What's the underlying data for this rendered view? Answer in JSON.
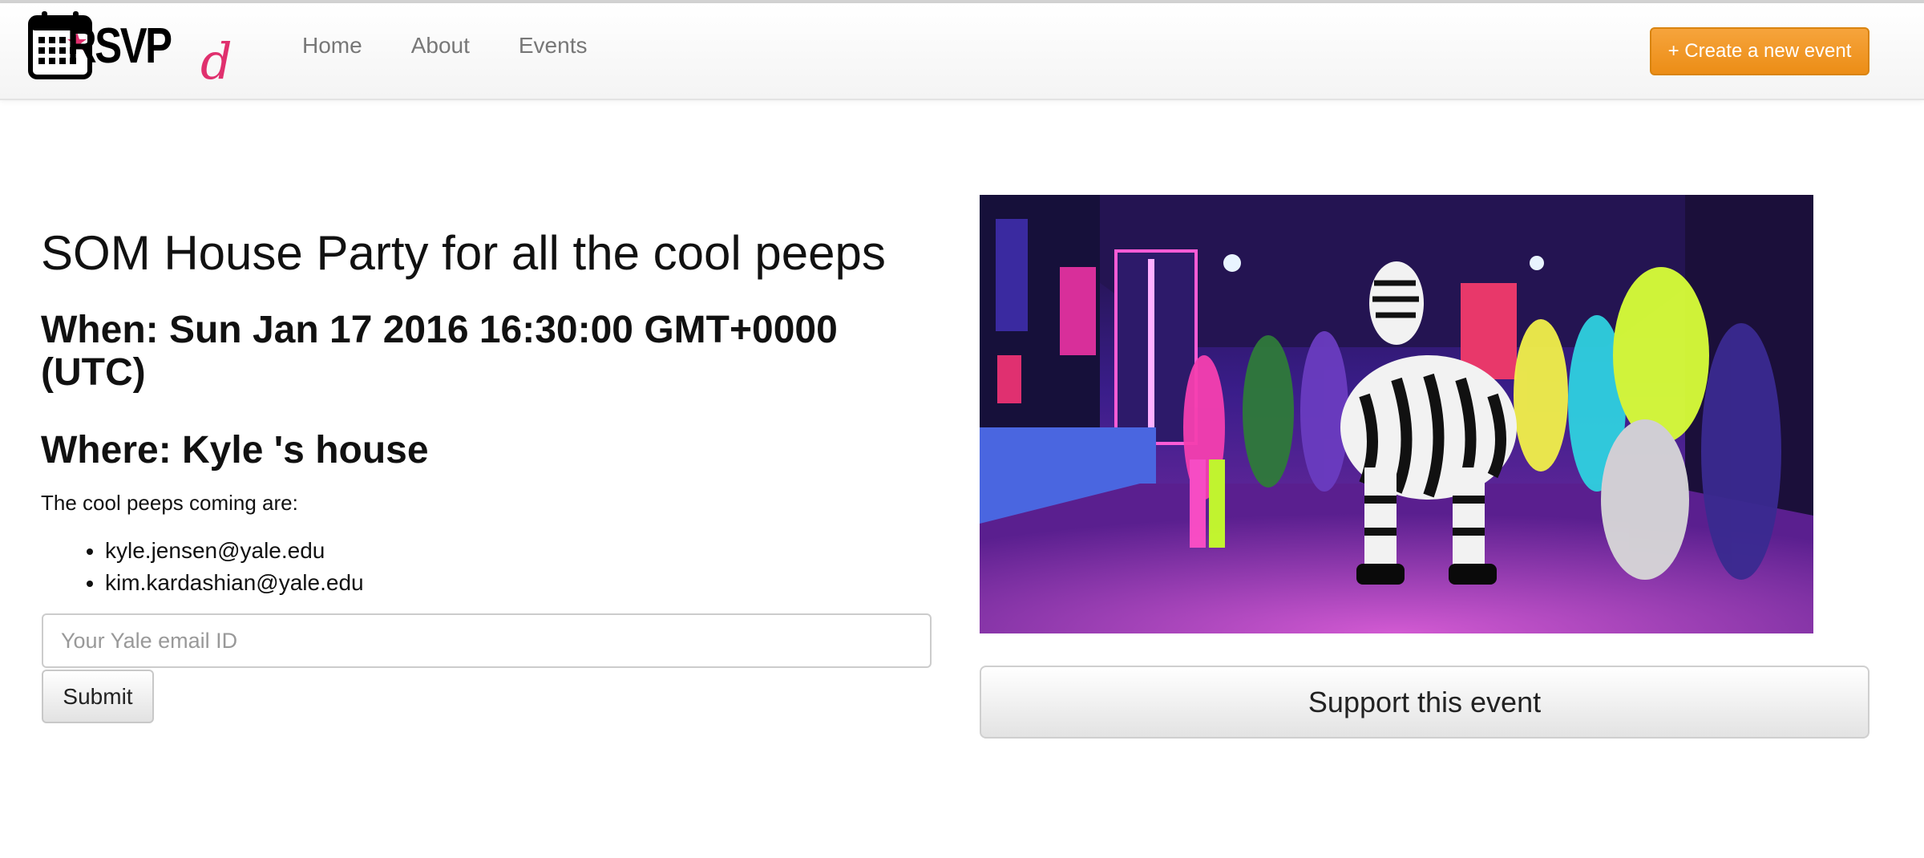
{
  "brand": {
    "name": "RSVP",
    "tail": "d",
    "logo_icon": "calendar-star-icon",
    "colors": {
      "star": "#e0306e",
      "tail": "#e0306e"
    }
  },
  "nav": {
    "links": [
      {
        "label": "Home"
      },
      {
        "label": "About"
      },
      {
        "label": "Events"
      }
    ],
    "create_button": "+ Create a new event",
    "create_button_color": "#f0961f"
  },
  "event": {
    "title": "SOM House Party for all the cool peeps",
    "when": "When: Sun Jan 17 2016 16:30:00 GMT+0000 (UTC)",
    "where": "Where: Kyle 's house",
    "attendees_intro": "The cool peeps coming are:",
    "attendees": [
      "kyle.jensen@yale.edu",
      "kim.kardashian@yale.edu"
    ]
  },
  "rsvp_form": {
    "email_placeholder": "Your Yale email ID",
    "email_value": "",
    "submit_label": "Submit"
  },
  "support": {
    "button_label": "Support this event"
  }
}
